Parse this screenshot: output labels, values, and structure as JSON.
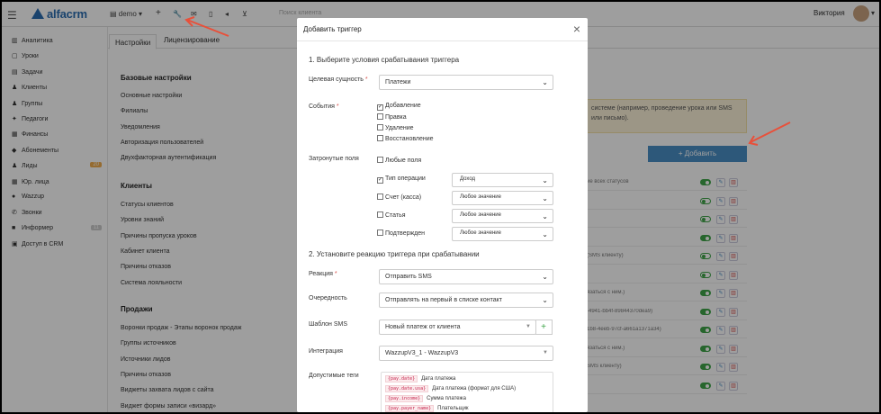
{
  "app": {
    "brand": "alfacrm",
    "branch": "demo",
    "search_placeholder": "Поиск клиента",
    "user": "Виктория"
  },
  "sidebar": {
    "items": [
      {
        "icon": "chart-icon",
        "label": "Аналитика"
      },
      {
        "icon": "calendar-icon",
        "label": "Уроки"
      },
      {
        "icon": "tasks-icon",
        "label": "Задачи"
      },
      {
        "icon": "user-icon",
        "label": "Клиенты"
      },
      {
        "icon": "users-icon",
        "label": "Группы"
      },
      {
        "icon": "teacher-icon",
        "label": "Педагоги"
      },
      {
        "icon": "money-icon",
        "label": "Финансы"
      },
      {
        "icon": "tag-icon",
        "label": "Абонементы"
      },
      {
        "icon": "leads-icon",
        "label": "Лиды",
        "badge": "20"
      },
      {
        "icon": "building-icon",
        "label": "Юр. лица"
      },
      {
        "icon": "whatsapp-icon",
        "label": "Wazzup"
      },
      {
        "icon": "phone-icon",
        "label": "Звонки"
      },
      {
        "icon": "informer-icon",
        "label": "Информер",
        "badge": "11"
      },
      {
        "icon": "login-icon",
        "label": "Доступ в CRM"
      }
    ]
  },
  "tabs": [
    "Настройки",
    "Лицензирование"
  ],
  "settings": {
    "base_title": "Базовые настройки",
    "base": [
      "Основные настройки",
      "Филиалы",
      "Уведомления",
      "Авторизация пользователей",
      "Двухфакторная аутентификация"
    ],
    "clients_title": "Клиенты",
    "clients": [
      "Статусы клиентов",
      "Уровни знаний",
      "Причины пропуска уроков",
      "Кабинет клиента",
      "Причины отказов",
      "Система лояльности"
    ],
    "sales_title": "Продажи",
    "sales": [
      "Воронки продаж - Этапы воронок продаж",
      "Группы источников",
      "Источники лидов",
      "Причины отказов",
      "Виджеты захвата лидов с сайта",
      "Виджет формы записи «визард»"
    ]
  },
  "background": {
    "warning": "системе (например, проведение урока или SMS или письмо).",
    "add_button": "+ Добавить",
    "rows": [
      "ие всех статусов",
      "",
      "",
      "",
      "(SMS клиенту)",
      "",
      "язаться с ним.)",
      "-4941-bb4f-89844370dea9)",
      "1b8-4eeb-97cf-a661a1371a34)",
      "язаться с ним.)",
      "SMS клиенту)",
      ""
    ]
  },
  "modal": {
    "title": "Добавить триггер",
    "step1": "1. Выберите условия срабатывания триггера",
    "entity_label": "Целевая сущность",
    "entity_value": "Платежи",
    "events_label": "События",
    "events": [
      {
        "label": "Добавление",
        "checked": true
      },
      {
        "label": "Правка",
        "checked": false
      },
      {
        "label": "Удаление",
        "checked": false
      },
      {
        "label": "Восстановление",
        "checked": false
      }
    ],
    "fields_label": "Затронутые поля",
    "any_fields": "Любые поля",
    "fields": [
      {
        "label": "Тип операции",
        "checked": true,
        "value": "Доход"
      },
      {
        "label": "Счет (касса)",
        "checked": false,
        "value": "Любое значение"
      },
      {
        "label": "Статья",
        "checked": false,
        "value": "Любое значение"
      },
      {
        "label": "Подтвержден",
        "checked": false,
        "value": "Любое значение"
      }
    ],
    "step2": "2. Установите реакцию триггера при срабатывании",
    "reaction_label": "Реакция",
    "reaction_value": "Отправить SMS",
    "order_label": "Очередность",
    "order_value": "Отправлять на первый в списке контакт",
    "template_label": "Шаблон SMS",
    "template_value": "Новый платеж от клиента",
    "integration_label": "Интеграция",
    "integration_value": "WazzupV3_1 - WazzupV3",
    "tags_label": "Допустимые теги",
    "tags": [
      {
        "tag": "{pay.date}",
        "desc": "Дата платежа"
      },
      {
        "tag": "{pay.date.usa}",
        "desc": "Дата платежа (формат для США)"
      },
      {
        "tag": "{pay.income}",
        "desc": "Сумма платежа"
      },
      {
        "tag": "{pay.payer_name}",
        "desc": "Плательщик"
      }
    ]
  },
  "colors": {
    "brand": "#2b6cb0",
    "accent": "#4a8fc6",
    "success": "#3fa54a",
    "danger": "#d9534f",
    "annotation": "#e8503a"
  }
}
